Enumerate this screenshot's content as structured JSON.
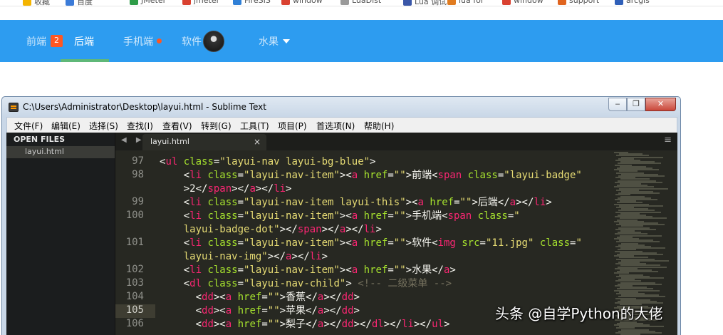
{
  "bookmarks": [
    {
      "label": "收藏",
      "color": "#f4b400"
    },
    {
      "label": "百度",
      "color": "#3b7bd8"
    },
    {
      "label": "JMeter",
      "color": "#2e9c48"
    },
    {
      "label": "jmeter",
      "color": "#d94130"
    },
    {
      "label": "FireSIS",
      "color": "#2f7fd6"
    },
    {
      "label": "window",
      "color": "#d94130"
    },
    {
      "label": "LuaDist",
      "color": "#999999"
    },
    {
      "label": "Lua 调试",
      "color": "#3a57a8"
    },
    {
      "label": "lua for",
      "color": "#e07b1f"
    },
    {
      "label": "window",
      "color": "#d94130"
    },
    {
      "label": "support",
      "color": "#e0641f"
    },
    {
      "label": "arcgis",
      "color": "#2f5fb8"
    }
  ],
  "nav": {
    "item1": "前端",
    "badge": "2",
    "item2": "后端",
    "item3": "手机端",
    "item4": "软件",
    "item5": "水果",
    "accent": "#5fb878",
    "bg": "#2d9cf0"
  },
  "window": {
    "title": "C:\\Users\\Administrator\\Desktop\\layui.html - Sublime Text",
    "controls": {
      "min": "‒",
      "restore": "❐",
      "close": "✕"
    }
  },
  "menu": [
    "文件(F)",
    "编辑(E)",
    "选择(S)",
    "查找(I)",
    "查看(V)",
    "转到(G)",
    "工具(T)",
    "项目(P)",
    "首选项(N)",
    "帮助(H)"
  ],
  "sidebar": {
    "header": "OPEN FILES",
    "file": "layui.html"
  },
  "tabbar": {
    "tab": "layui.html",
    "close": "×",
    "arrows": "◀ ▶",
    "menu": "≡"
  },
  "editor": {
    "line_numbers": [
      "97",
      "98",
      "",
      "99",
      "100",
      "",
      "101",
      "",
      "102",
      "103",
      "104",
      "105",
      "106"
    ],
    "current_line": "105"
  },
  "watermark": "头条 @自学Python的大佬"
}
